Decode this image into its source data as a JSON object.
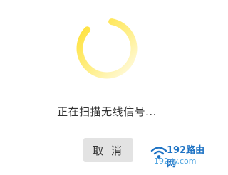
{
  "status": {
    "message": "正在扫描无线信号..."
  },
  "actions": {
    "cancel_label": "取 消"
  },
  "watermark": {
    "title": "192路由网",
    "url": "192.ly.com"
  },
  "colors": {
    "spinner": "#ffe033",
    "button_bg": "#e3e3e3",
    "watermark_blue": "#1e73c4"
  },
  "icons": {
    "spinner": "loading-spinner-icon",
    "watermark": "wifi-logo-icon"
  }
}
